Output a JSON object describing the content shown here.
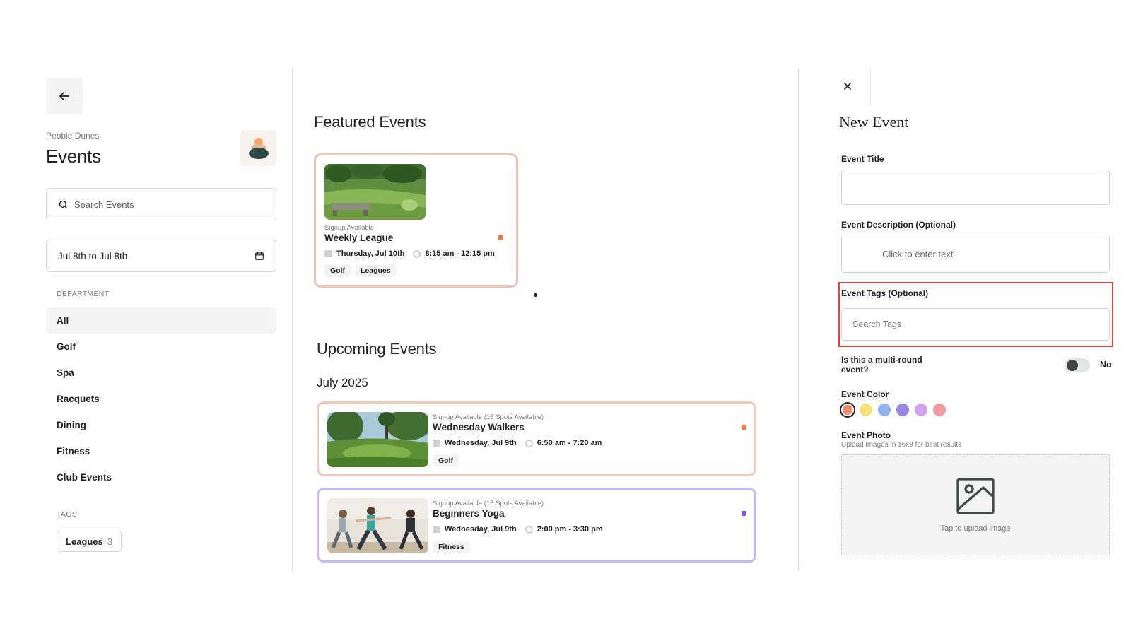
{
  "sidebar": {
    "club_name": "Pebble Dunes",
    "title": "Events",
    "search_placeholder": "Search Events",
    "date_range": "Jul 8th to Jul 8th",
    "department_label": "DEPARTMENT",
    "departments": [
      {
        "label": "All",
        "active": true
      },
      {
        "label": "Golf"
      },
      {
        "label": "Spa"
      },
      {
        "label": "Racquets"
      },
      {
        "label": "Dining"
      },
      {
        "label": "Fitness"
      },
      {
        "label": "Club Events"
      }
    ],
    "tags_label": "TAGS",
    "tags": [
      {
        "label": "Leagues",
        "count": "3"
      }
    ]
  },
  "featured": {
    "heading": "Featured Events",
    "cards": [
      {
        "signup": "Signup Available",
        "title": "Weekly League",
        "date": "Thursday, Jul 10th",
        "time": "8:15 am - 12:15 pm",
        "chips": [
          "Golf",
          "Leagues"
        ],
        "accent": "#f3c2b6",
        "dot": "#f07a4b"
      }
    ]
  },
  "upcoming": {
    "heading": "Upcoming Events",
    "month": "July 2025",
    "cards": [
      {
        "signup": "Signup Available (15 Spots Available)",
        "title": "Wednesday Walkers",
        "date": "Wednesday, Jul 9th",
        "time": "6:50 am - 7:20 am",
        "chips": [
          "Golf"
        ],
        "accent": "#f6c8ba",
        "dot": "#f07a4b"
      },
      {
        "signup": "Signup Available (16 Spots Available)",
        "title": "Beginners Yoga",
        "date": "Wednesday, Jul 9th",
        "time": "2:00 pm - 3:30 pm",
        "chips": [
          "Fitness"
        ],
        "accent": "#c9b8f3",
        "dot": "#7a52d6"
      }
    ]
  },
  "form": {
    "title": "New Event",
    "event_title_label": "Event Title",
    "event_title_value": "",
    "description_label": "Event Description (Optional)",
    "description_placeholder": "Click to enter text",
    "tags_label": "Event Tags (Optional)",
    "tags_placeholder": "Search Tags",
    "multi_round_label": "Is this a multi-round event?",
    "multi_round_value": "No",
    "color_label": "Event Color",
    "colors": [
      "#f08a6c",
      "#f6e27a",
      "#8fb4ef",
      "#9b86e6",
      "#d2a2ef",
      "#f09aa4"
    ],
    "photo_label": "Event Photo",
    "photo_hint": "Upload images in 16x9 for best results",
    "upload_text": "Tap to upload image"
  }
}
